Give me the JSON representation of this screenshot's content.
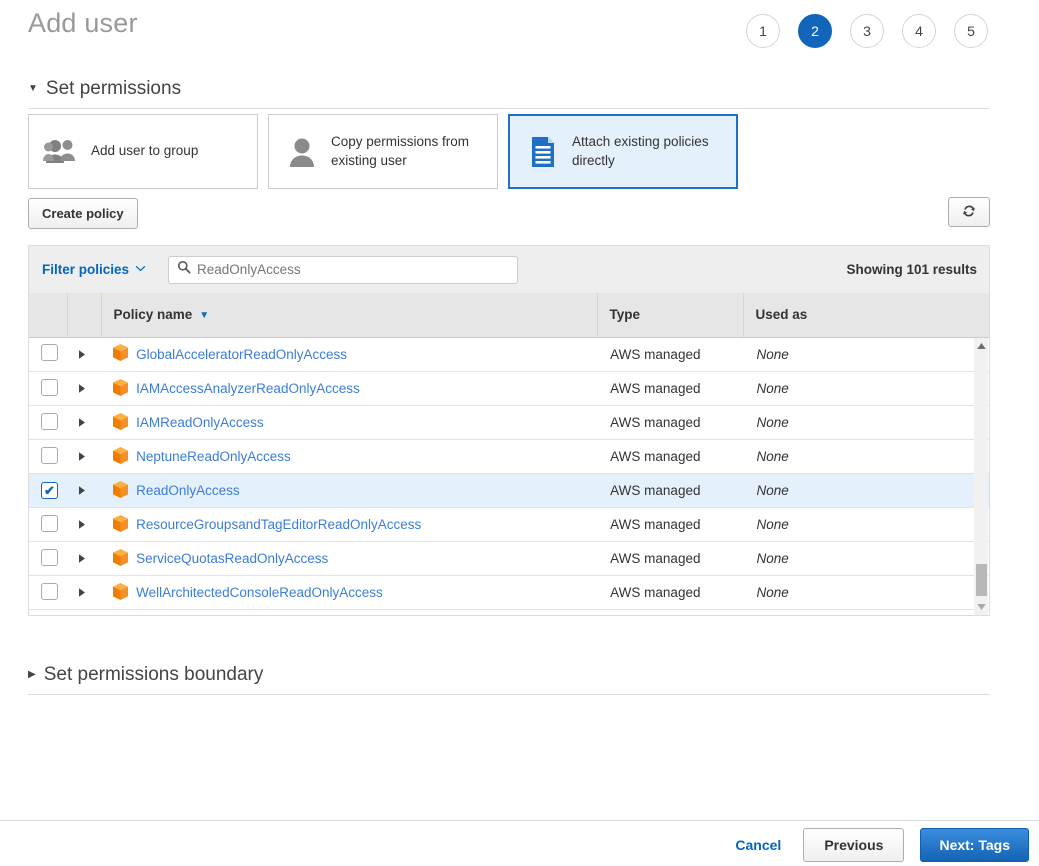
{
  "header": {
    "title": "Add user",
    "steps": [
      {
        "label": "1",
        "active": false
      },
      {
        "label": "2",
        "active": true
      },
      {
        "label": "3",
        "active": false
      },
      {
        "label": "4",
        "active": false
      },
      {
        "label": "5",
        "active": false
      }
    ]
  },
  "sections": {
    "permissions": {
      "title": "Set permissions",
      "expanded": true,
      "caret": "▼"
    },
    "boundary": {
      "title": "Set permissions boundary",
      "expanded": false,
      "caret": "▶"
    }
  },
  "permission_options": [
    {
      "label": "Add user to group",
      "icon": "users-group-icon",
      "selected": false
    },
    {
      "label": "Copy permissions from existing user",
      "icon": "user-icon",
      "selected": false
    },
    {
      "label": "Attach existing policies directly",
      "icon": "document-policy-icon",
      "selected": true
    }
  ],
  "toolbar": {
    "create_policy_label": "Create policy",
    "refresh_icon": "refresh-icon"
  },
  "filter_bar": {
    "filter_label": "Filter policies",
    "filter_chevron": "⌄",
    "search_icon": "search-icon",
    "search_value": "ReadOnlyAccess",
    "search_placeholder": "Search",
    "results_text": "Showing 101 results"
  },
  "table": {
    "columns": [
      {
        "key": "check",
        "label": ""
      },
      {
        "key": "expand",
        "label": ""
      },
      {
        "key": "name",
        "label": "Policy name",
        "sorted": true,
        "sort_caret": "▼"
      },
      {
        "key": "type",
        "label": "Type"
      },
      {
        "key": "used",
        "label": "Used as"
      }
    ],
    "rows": [
      {
        "name": "GlobalAcceleratorReadOnlyAccess",
        "type": "AWS managed",
        "used_as": "None",
        "selected": false
      },
      {
        "name": "IAMAccessAnalyzerReadOnlyAccess",
        "type": "AWS managed",
        "used_as": "None",
        "selected": false
      },
      {
        "name": "IAMReadOnlyAccess",
        "type": "AWS managed",
        "used_as": "None",
        "selected": false
      },
      {
        "name": "NeptuneReadOnlyAccess",
        "type": "AWS managed",
        "used_as": "None",
        "selected": false
      },
      {
        "name": "ReadOnlyAccess",
        "type": "AWS managed",
        "used_as": "None",
        "selected": true
      },
      {
        "name": "ResourceGroupsandTagEditorReadOnlyAccess",
        "type": "AWS managed",
        "used_as": "None",
        "selected": false
      },
      {
        "name": "ServiceQuotasReadOnlyAccess",
        "type": "AWS managed",
        "used_as": "None",
        "selected": false
      },
      {
        "name": "WellArchitectedConsoleReadOnlyAccess",
        "type": "AWS managed",
        "used_as": "None",
        "selected": false
      }
    ],
    "row_icon": "policy-cube-icon",
    "expand_caret": "▶",
    "checked_glyph": "✔",
    "scrollbar": {
      "up_arrow": "▲",
      "down_arrow": "▼"
    }
  },
  "footer": {
    "cancel_label": "Cancel",
    "previous_label": "Previous",
    "next_label": "Next: Tags"
  },
  "colors": {
    "accent_blue": "#1166bb",
    "link_blue": "#0066c0",
    "policy_link_blue": "#3b7dd8",
    "selected_row": "#e4f0fb",
    "cube_orange": "#f59029",
    "next_button": "#1463b5"
  }
}
